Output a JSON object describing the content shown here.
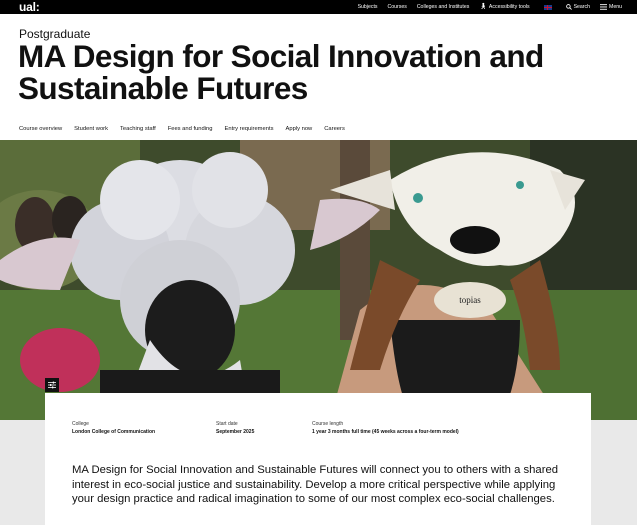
{
  "topbar": {
    "logo": "ual:",
    "nav": [
      {
        "label": "Subjects"
      },
      {
        "label": "Courses"
      },
      {
        "label": "Colleges and Institutes"
      },
      {
        "label": "Accessibility tools",
        "icon": "accessibility-icon"
      },
      {
        "label": "",
        "icon": "uk-flag-icon"
      },
      {
        "label": "Search",
        "icon": "search-icon"
      },
      {
        "label": "Menu",
        "icon": "menu-icon"
      }
    ]
  },
  "header": {
    "kicker": "Postgraduate",
    "title": "MA Design for Social Innovation and Sustainable Futures"
  },
  "subnav": [
    "Course overview",
    "Student work",
    "Teaching staff",
    "Fees and funding",
    "Entry requirements",
    "Apply now",
    "Careers"
  ],
  "hero": {
    "mask_text": "topias"
  },
  "card": {
    "facts": [
      {
        "label": "College",
        "value": "London College of Communication"
      },
      {
        "label": "Start date",
        "value": "September 2025"
      },
      {
        "label": "Course length",
        "value": "1 year 3 months full time (45 weeks across a four-term model)"
      }
    ],
    "description": "MA Design for Social Innovation and Sustainable Futures will connect you to others with a shared interest in eco-social justice and sustainability. Develop a more critical perspective while applying your design practice and radical imagination to some of our most complex eco-social challenges."
  }
}
